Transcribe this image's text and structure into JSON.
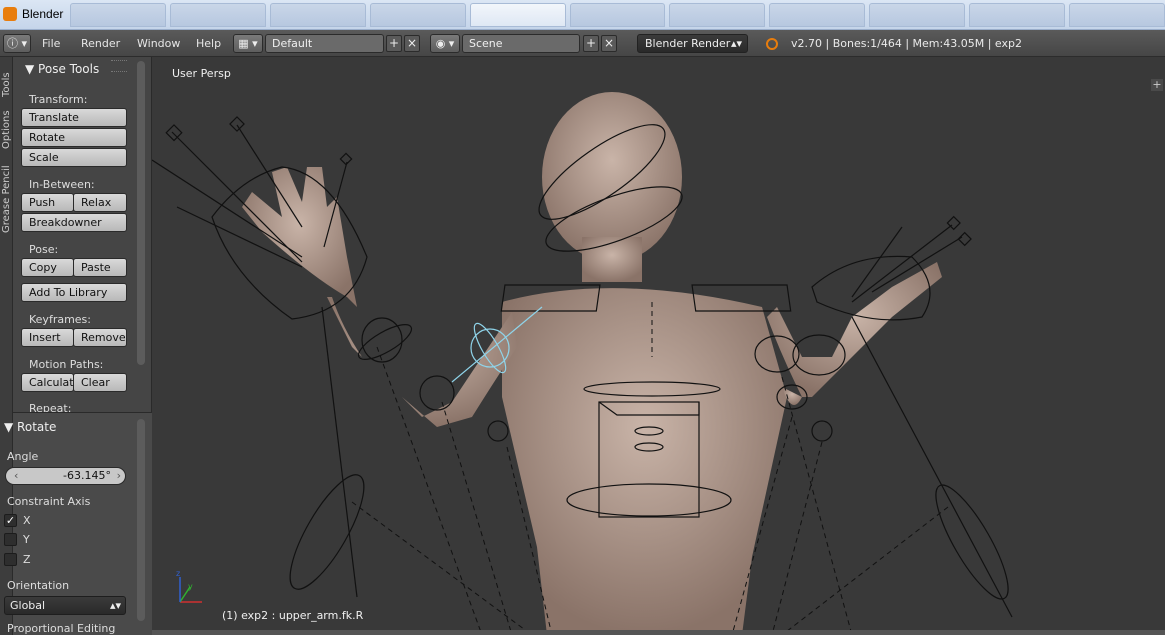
{
  "window": {
    "title": "Blender"
  },
  "menu": {
    "file": "File",
    "render": "Render",
    "window": "Window",
    "help": "Help"
  },
  "header": {
    "screen_layout": "Default",
    "scene": "Scene",
    "render_engine": "Blender Render",
    "stats": "v2.70 | Bones:1/464  | Mem:43.05M | exp2"
  },
  "sidebar_tabs": [
    "Tools",
    "Options",
    "Grease Pencil"
  ],
  "pose_tools": {
    "title": "Pose Tools",
    "transform_label": "Transform:",
    "translate": "Translate",
    "rotate": "Rotate",
    "scale": "Scale",
    "inbetween_label": "In-Between:",
    "push": "Push",
    "relax": "Relax",
    "breakdowner": "Breakdowner",
    "pose_label": "Pose:",
    "copy": "Copy",
    "paste": "Paste",
    "add_to_library": "Add To Library",
    "keyframes_label": "Keyframes:",
    "insert": "Insert",
    "remove": "Remove",
    "motion_paths_label": "Motion Paths:",
    "calculate": "Calculat",
    "clear": "Clear",
    "repeat_label": "Repeat:"
  },
  "operator_panel": {
    "title": "Rotate",
    "angle_label": "Angle",
    "angle_value": "-63.145°",
    "constraint_axis_label": "Constraint Axis",
    "axis_x": "X",
    "axis_y": "Y",
    "axis_z": "Z",
    "axis_x_checked": "✓",
    "orientation_label": "Orientation",
    "orientation_value": "Global",
    "proportional_label": "Proportional Editing"
  },
  "viewport": {
    "view_label": "User Persp",
    "object_label": "(1) exp2 : upper_arm.fk.R"
  },
  "icons": [
    "info-icon",
    "screen-layout-icon",
    "scene-icon",
    "blender-logo-icon",
    "add-icon",
    "close-icon",
    "axis-gizmo-icon"
  ]
}
